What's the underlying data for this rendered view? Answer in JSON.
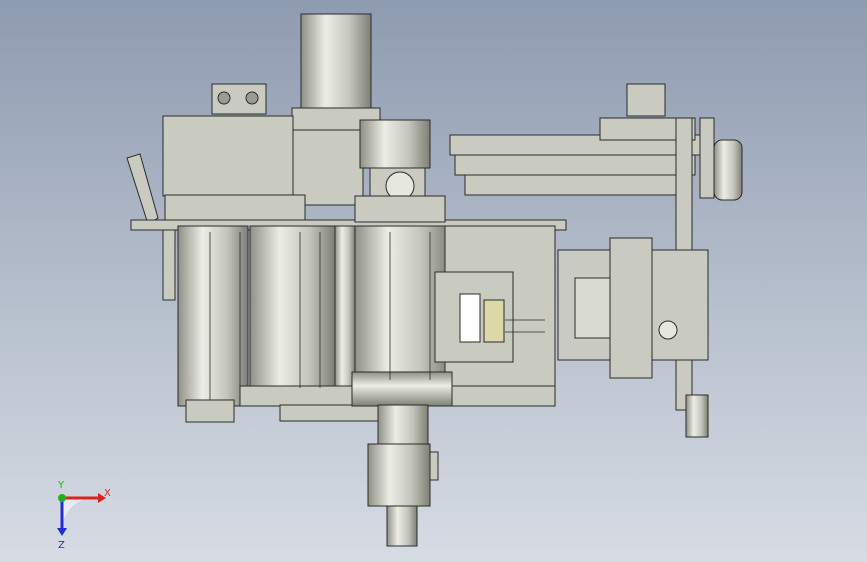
{
  "viewport": {
    "background_top": "#8e9bb0",
    "background_bottom": "#d7dce4"
  },
  "model": {
    "metal_color": "#c9cbc1",
    "dark_edge_color": "#2b2b2b"
  },
  "triad": {
    "x_label": "X",
    "y_label": "Y",
    "z_label": "Z",
    "x_color": "#e02020",
    "y_color": "#20b020",
    "z_color": "#2030d0"
  }
}
